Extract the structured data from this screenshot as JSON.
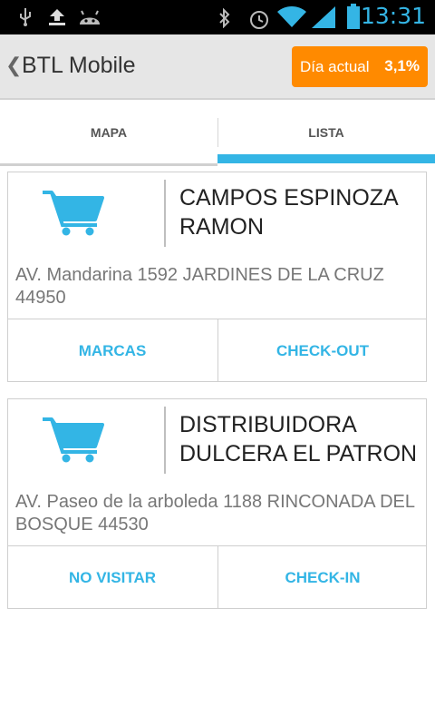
{
  "status_bar": {
    "time": "13:31",
    "icons": [
      "usb-icon",
      "upload-icon",
      "android-icon",
      "bluetooth-icon",
      "alarm-icon",
      "wifi-icon",
      "signal-icon",
      "battery-icon"
    ],
    "accent_color": "#34b5e5"
  },
  "action_bar": {
    "title": "BTL Mobile",
    "badge_label": "Día actual",
    "badge_value": "3,1%",
    "badge_color": "#ff8a00"
  },
  "tabs": [
    {
      "label": "MAPA",
      "selected": false
    },
    {
      "label": "LISTA",
      "selected": true
    }
  ],
  "stores": [
    {
      "name": "CAMPOS ESPINOZA RAMON",
      "address": "AV.   Mandarina  1592 JARDINES DE LA CRUZ  44950",
      "left_action": "MARCAS",
      "right_action": "CHECK-OUT"
    },
    {
      "name": "DISTRIBUIDORA DULCERA EL PATRON",
      "address": "AV.   Paseo de la arboleda  1188 RINCONADA DEL BOSQUE  44530",
      "left_action": "NO VISITAR",
      "right_action": "CHECK-IN"
    }
  ]
}
